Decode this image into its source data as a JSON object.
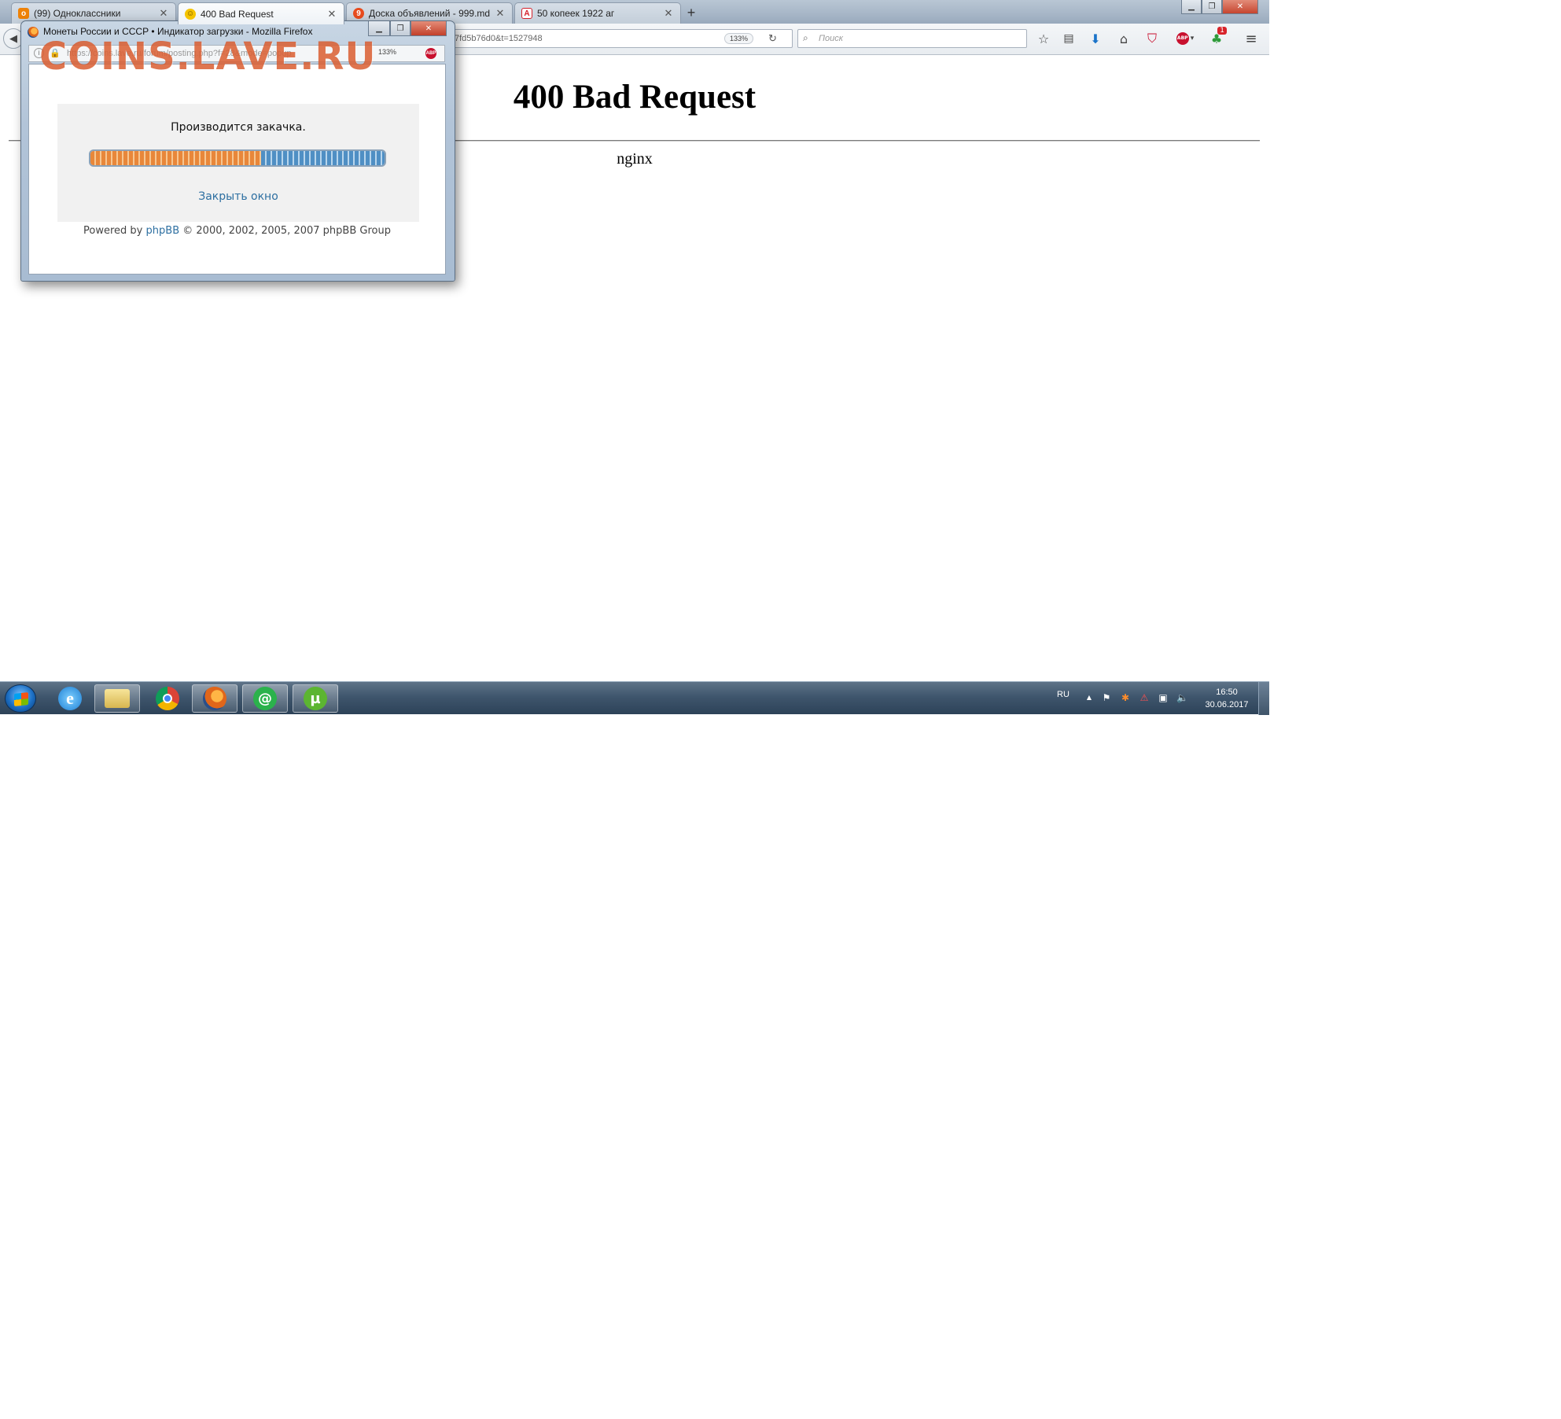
{
  "browser": {
    "tabs": [
      {
        "label": "(99) Одноклассники",
        "favicon_color": "#ee8208",
        "favicon_glyph": "ok-icon"
      },
      {
        "label": "400 Bad Request",
        "favicon_color": "#f5c400",
        "favicon_glyph": "smiley-icon",
        "active": true
      },
      {
        "label": "Доска объявлений - 999.md",
        "favicon_color": "#e84b1d",
        "favicon_glyph": "999-icon"
      },
      {
        "label": "50 копеек 1922 аг",
        "favicon_color": "#d4202a",
        "favicon_glyph": "a-icon"
      }
    ],
    "new_tab": "+",
    "url_fragment": "7fd5b76d0&t=1527948",
    "zoom": "133%",
    "search_placeholder": "Поиск",
    "notification_badge": "1"
  },
  "page": {
    "error_title": "400 Bad Request",
    "server": "nginx"
  },
  "popup": {
    "window_title": "Монеты России и СССР • Индикатор загрузки - Mozilla Firefox",
    "url": "https://coins.lave.ru/forum/posting.php?f=28&mode=popup",
    "zoom": "133%",
    "message": "Производится закачка.",
    "progress": 0.58,
    "close_link": "Закрыть окно",
    "footer_prefix": "Powered by",
    "footer_link": "phpBB",
    "footer_suffix": "© 2000, 2002, 2005, 2007 phpBB Group"
  },
  "watermark": "COINS.LAVE.RU",
  "taskbar": {
    "language": "RU",
    "time": "16:50",
    "date": "30.06.2017"
  }
}
